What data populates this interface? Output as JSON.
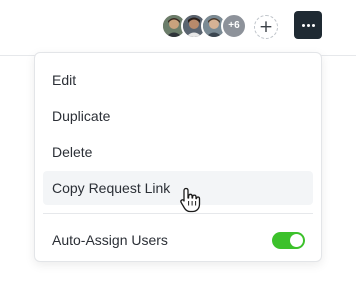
{
  "toolbar": {
    "avatars": [
      {
        "name": "avatar-1",
        "skin": "#c9a27d",
        "hair": "#3a2b22",
        "bg": "#6b7d6a"
      },
      {
        "name": "avatar-2",
        "skin": "#b88a6b",
        "hair": "#2a201b",
        "bg": "#5a6470"
      },
      {
        "name": "avatar-3",
        "skin": "#d6b295",
        "hair": "#4a3a2c",
        "bg": "#7a8a94"
      }
    ],
    "more_avatars_count": "+6",
    "add_user_icon": "plus-icon",
    "more_icon": "ellipsis-icon"
  },
  "menu": {
    "items": [
      {
        "label": "Edit"
      },
      {
        "label": "Duplicate"
      },
      {
        "label": "Delete"
      },
      {
        "label": "Copy Request Link",
        "hovered": true
      }
    ],
    "toggle": {
      "label": "Auto-Assign Users",
      "on": true
    }
  },
  "colors": {
    "accent_toggle": "#3cc12b",
    "more_button_bg": "#1f2a33",
    "hover_bg": "#f3f5f7"
  }
}
